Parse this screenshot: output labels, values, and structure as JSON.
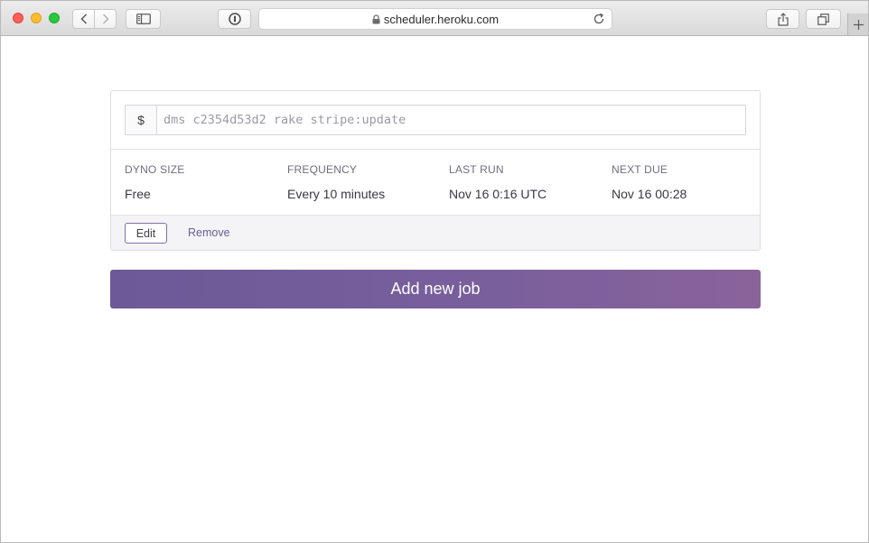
{
  "browser": {
    "url": "scheduler.heroku.com",
    "icons": {
      "back": "chevron-left-icon",
      "forward": "chevron-right-icon",
      "sidebar": "sidebar-icon",
      "privacy": "privacy-report-icon",
      "lock": "lock-icon",
      "reload": "reload-icon",
      "share": "share-icon",
      "tabs": "tab-overview-icon",
      "new_tab": "plus-icon"
    }
  },
  "job": {
    "command_prefix": "$",
    "command_placeholder": "dms c2354d53d2 rake stripe:update",
    "fields": [
      {
        "label": "DYNO SIZE",
        "value": "Free"
      },
      {
        "label": "FREQUENCY",
        "value": "Every 10 minutes"
      },
      {
        "label": "LAST RUN",
        "value": "Nov 16 0:16 UTC"
      },
      {
        "label": "NEXT DUE",
        "value": "Nov 16 00:28"
      }
    ],
    "edit_label": "Edit",
    "remove_label": "Remove"
  },
  "add_job_label": "Add new job",
  "colors": {
    "accent": "#79609d",
    "link": "#6b5d99",
    "traffic_close": "#fe5f57",
    "traffic_minimize": "#febc2e",
    "traffic_maximize": "#28c840"
  }
}
